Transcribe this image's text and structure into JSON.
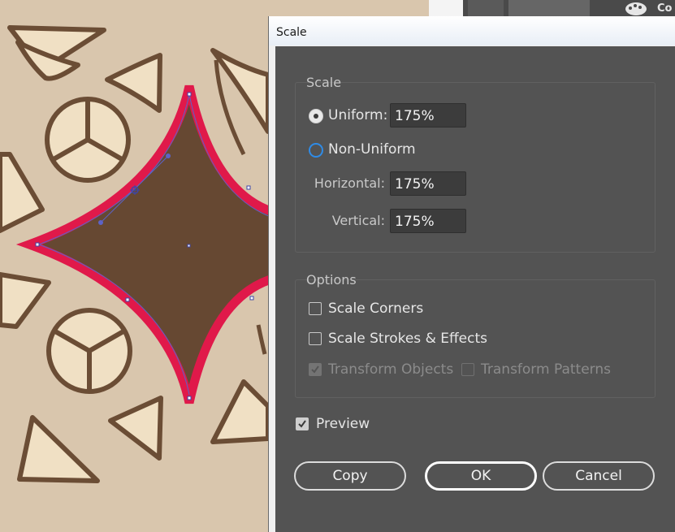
{
  "topbar": {
    "label": "Co"
  },
  "dialog": {
    "title": "Scale",
    "scale_group": {
      "label": "Scale",
      "uniform_label": "Uniform:",
      "uniform_value": "175%",
      "uniform_selected": true,
      "non_uniform_label": "Non-Uniform",
      "horizontal_label": "Horizontal:",
      "horizontal_value": "175%",
      "vertical_label": "Vertical:",
      "vertical_value": "175%"
    },
    "options_group": {
      "label": "Options",
      "scale_corners_label": "Scale Corners",
      "scale_corners_checked": false,
      "scale_strokes_label": "Scale Strokes & Effects",
      "scale_strokes_checked": false,
      "transform_objects_label": "Transform Objects",
      "transform_objects_checked": true,
      "transform_patterns_label": "Transform Patterns",
      "transform_patterns_checked": false
    },
    "preview_label": "Preview",
    "preview_checked": true,
    "buttons": {
      "copy": "Copy",
      "ok": "OK",
      "cancel": "Cancel"
    }
  },
  "colors": {
    "canvas_bg": "#d9c6ad",
    "ornament_stroke": "#6b4d35",
    "ornament_fill": "#f0e0c4",
    "selected_shape_fill": "#664832",
    "selection_stroke": "#e0194a",
    "path_outline": "#5c63c8",
    "dialog_bg": "#535353",
    "radio_accent": "#2f8be6"
  }
}
